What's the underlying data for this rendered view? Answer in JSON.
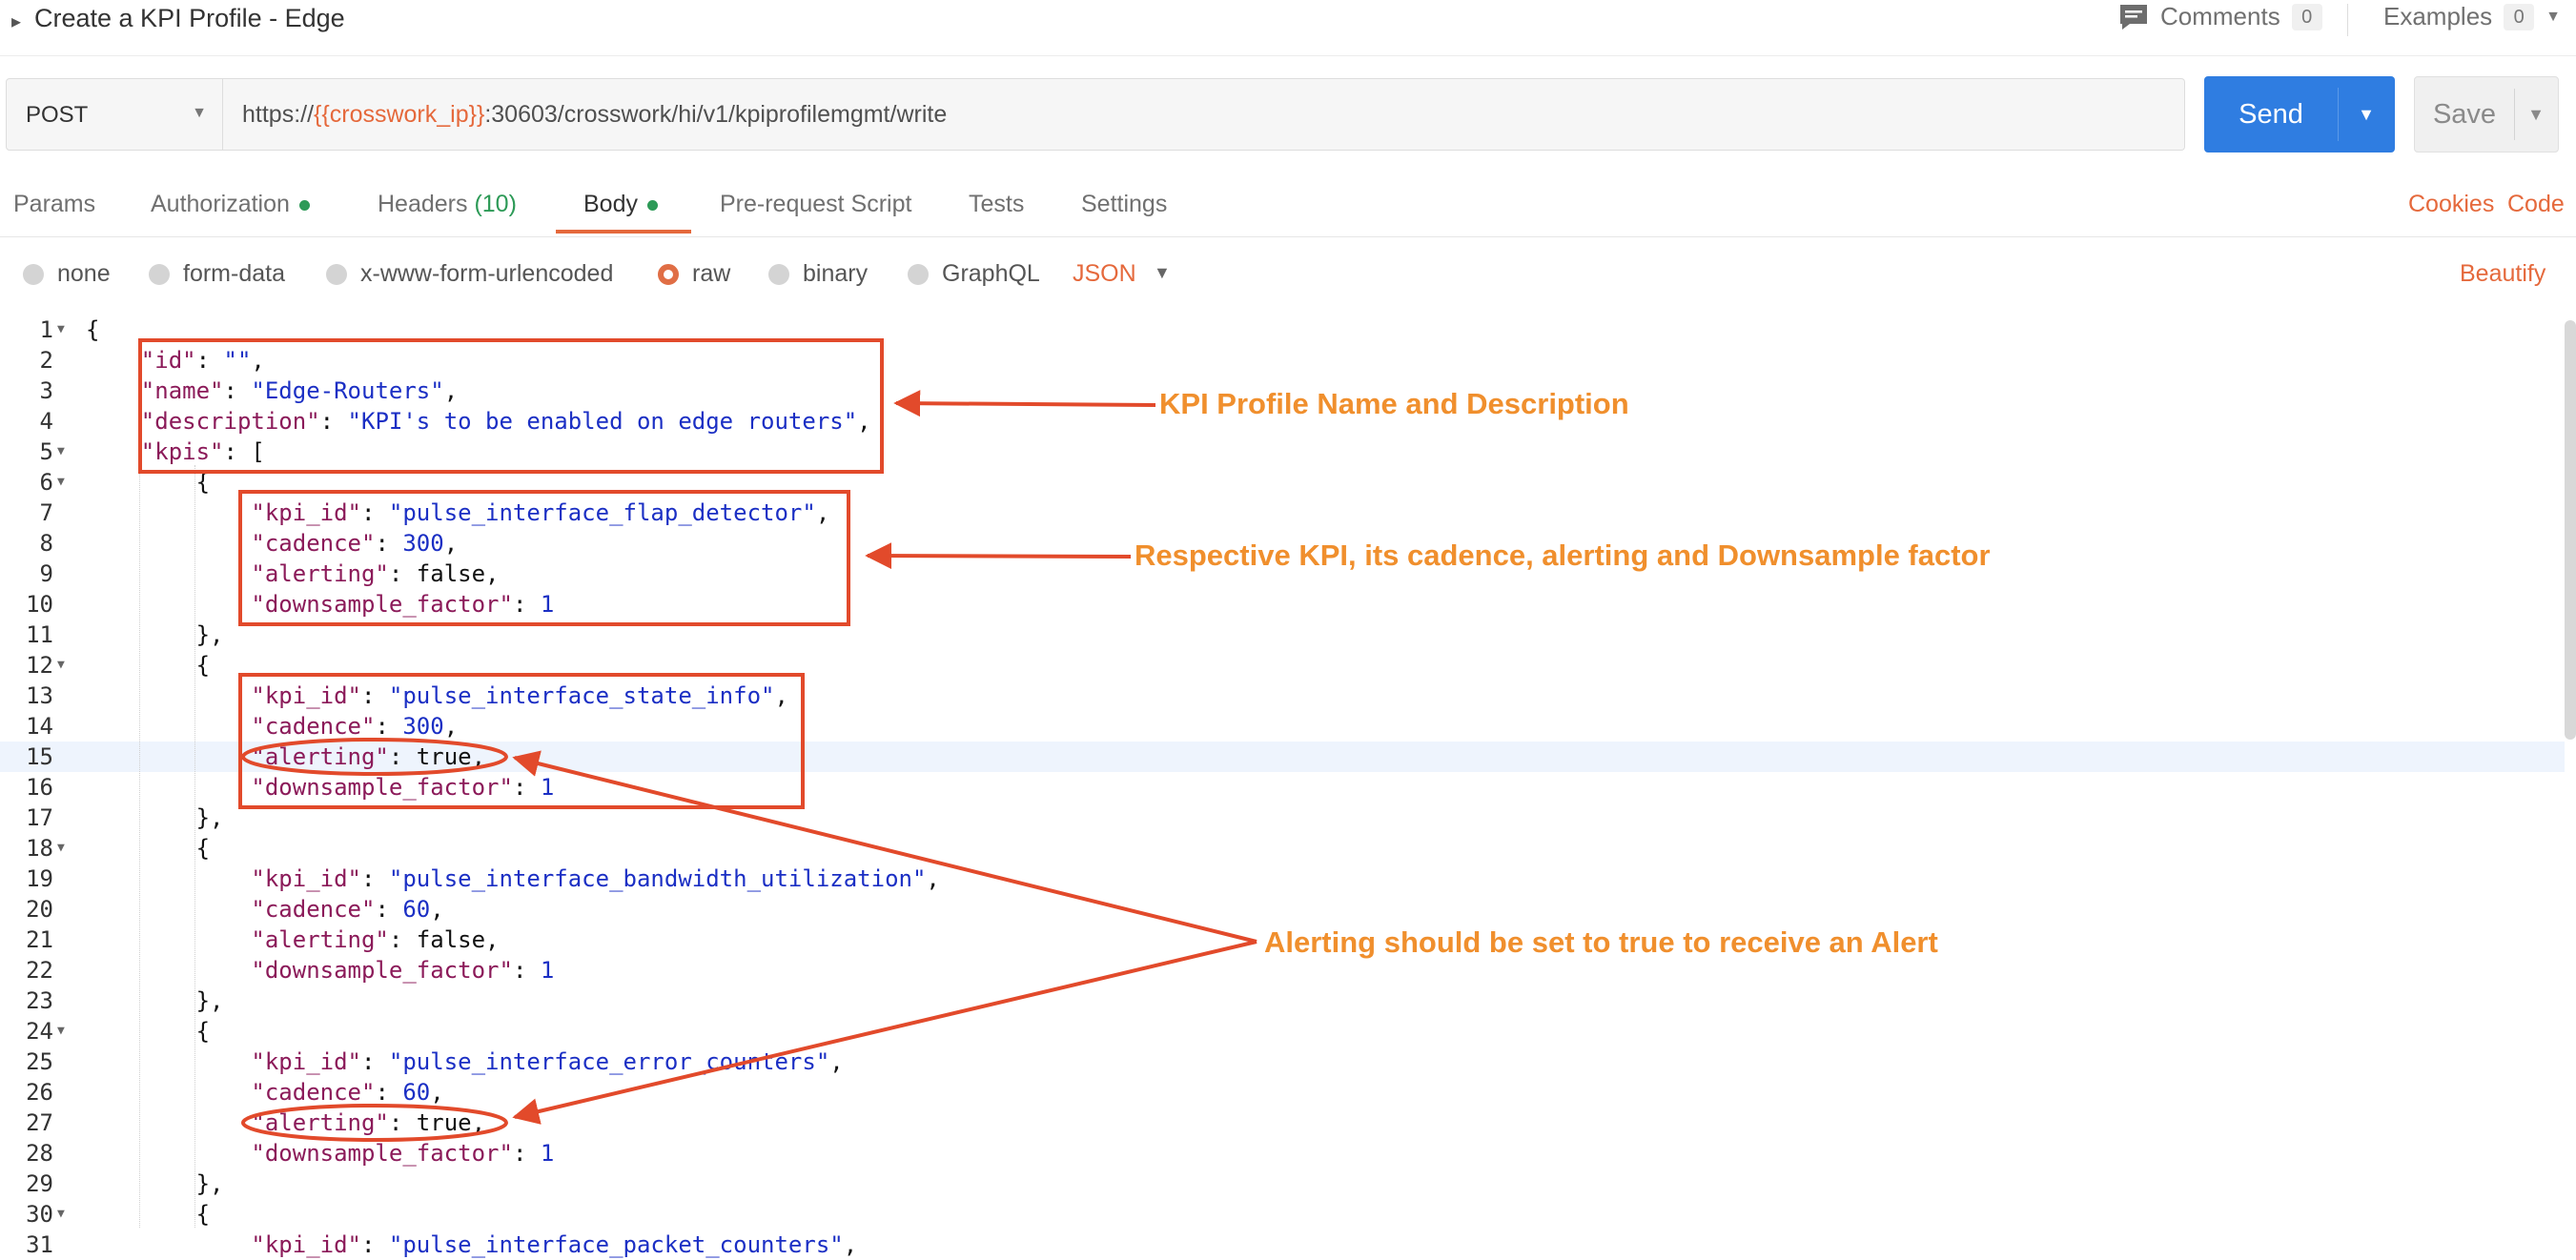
{
  "header": {
    "title": "Create a KPI Profile - Edge",
    "comments_label": "Comments",
    "comments_count": "0",
    "examples_label": "Examples",
    "examples_count": "0"
  },
  "request": {
    "method": "POST",
    "url_prefix": "https://",
    "url_variable": "{{crosswork_ip}}",
    "url_suffix": ":30603/crosswork/hi/v1/kpiprofilemgmt/write",
    "send_label": "Send",
    "save_label": "Save"
  },
  "tabs": {
    "params": "Params",
    "authorization": "Authorization",
    "headers": "Headers",
    "headers_count": "(10)",
    "body": "Body",
    "prerequest": "Pre-request Script",
    "tests": "Tests",
    "settings": "Settings",
    "cookies": "Cookies",
    "code": "Code"
  },
  "body_options": {
    "none": "none",
    "form_data": "form-data",
    "urlencoded": "x-www-form-urlencoded",
    "raw": "raw",
    "binary": "binary",
    "graphql": "GraphQL",
    "format": "JSON",
    "beautify": "Beautify"
  },
  "code_lines": [
    [
      {
        "c": "p",
        "t": "{"
      }
    ],
    [
      {
        "c": "p",
        "t": "    "
      },
      {
        "c": "k",
        "t": "\"id\""
      },
      {
        "c": "p",
        "t": ": "
      },
      {
        "c": "s",
        "t": "\"\""
      },
      {
        "c": "p",
        "t": ","
      }
    ],
    [
      {
        "c": "p",
        "t": "    "
      },
      {
        "c": "k",
        "t": "\"name\""
      },
      {
        "c": "p",
        "t": ": "
      },
      {
        "c": "s",
        "t": "\"Edge-Routers\""
      },
      {
        "c": "p",
        "t": ","
      }
    ],
    [
      {
        "c": "p",
        "t": "    "
      },
      {
        "c": "k",
        "t": "\"description\""
      },
      {
        "c": "p",
        "t": ": "
      },
      {
        "c": "s",
        "t": "\"KPI's to be enabled on edge routers\""
      },
      {
        "c": "p",
        "t": ","
      }
    ],
    [
      {
        "c": "p",
        "t": "    "
      },
      {
        "c": "k",
        "t": "\"kpis\""
      },
      {
        "c": "p",
        "t": ": ["
      }
    ],
    [
      {
        "c": "p",
        "t": "        {"
      }
    ],
    [
      {
        "c": "p",
        "t": "            "
      },
      {
        "c": "k",
        "t": "\"kpi_id\""
      },
      {
        "c": "p",
        "t": ": "
      },
      {
        "c": "s",
        "t": "\"pulse_interface_flap_detector\""
      },
      {
        "c": "p",
        "t": ","
      }
    ],
    [
      {
        "c": "p",
        "t": "            "
      },
      {
        "c": "k",
        "t": "\"cadence\""
      },
      {
        "c": "p",
        "t": ": "
      },
      {
        "c": "n",
        "t": "300"
      },
      {
        "c": "p",
        "t": ","
      }
    ],
    [
      {
        "c": "p",
        "t": "            "
      },
      {
        "c": "k",
        "t": "\"alerting\""
      },
      {
        "c": "p",
        "t": ": false,"
      }
    ],
    [
      {
        "c": "p",
        "t": "            "
      },
      {
        "c": "k",
        "t": "\"downsample_factor\""
      },
      {
        "c": "p",
        "t": ": "
      },
      {
        "c": "n",
        "t": "1"
      }
    ],
    [
      {
        "c": "p",
        "t": "        },"
      }
    ],
    [
      {
        "c": "p",
        "t": "        {"
      }
    ],
    [
      {
        "c": "p",
        "t": "            "
      },
      {
        "c": "k",
        "t": "\"kpi_id\""
      },
      {
        "c": "p",
        "t": ": "
      },
      {
        "c": "s",
        "t": "\"pulse_interface_state_info\""
      },
      {
        "c": "p",
        "t": ","
      }
    ],
    [
      {
        "c": "p",
        "t": "            "
      },
      {
        "c": "k",
        "t": "\"cadence\""
      },
      {
        "c": "p",
        "t": ": "
      },
      {
        "c": "n",
        "t": "300"
      },
      {
        "c": "p",
        "t": ","
      }
    ],
    [
      {
        "c": "p",
        "t": "            "
      },
      {
        "c": "k",
        "t": "\"alerting\""
      },
      {
        "c": "p",
        "t": ": true,"
      }
    ],
    [
      {
        "c": "p",
        "t": "            "
      },
      {
        "c": "k",
        "t": "\"downsample_factor\""
      },
      {
        "c": "p",
        "t": ": "
      },
      {
        "c": "n",
        "t": "1"
      }
    ],
    [
      {
        "c": "p",
        "t": "        },"
      }
    ],
    [
      {
        "c": "p",
        "t": "        {"
      }
    ],
    [
      {
        "c": "p",
        "t": "            "
      },
      {
        "c": "k",
        "t": "\"kpi_id\""
      },
      {
        "c": "p",
        "t": ": "
      },
      {
        "c": "s",
        "t": "\"pulse_interface_bandwidth_utilization\""
      },
      {
        "c": "p",
        "t": ","
      }
    ],
    [
      {
        "c": "p",
        "t": "            "
      },
      {
        "c": "k",
        "t": "\"cadence\""
      },
      {
        "c": "p",
        "t": ": "
      },
      {
        "c": "n",
        "t": "60"
      },
      {
        "c": "p",
        "t": ","
      }
    ],
    [
      {
        "c": "p",
        "t": "            "
      },
      {
        "c": "k",
        "t": "\"alerting\""
      },
      {
        "c": "p",
        "t": ": false,"
      }
    ],
    [
      {
        "c": "p",
        "t": "            "
      },
      {
        "c": "k",
        "t": "\"downsample_factor\""
      },
      {
        "c": "p",
        "t": ": "
      },
      {
        "c": "n",
        "t": "1"
      }
    ],
    [
      {
        "c": "p",
        "t": "        },"
      }
    ],
    [
      {
        "c": "p",
        "t": "        {"
      }
    ],
    [
      {
        "c": "p",
        "t": "            "
      },
      {
        "c": "k",
        "t": "\"kpi_id\""
      },
      {
        "c": "p",
        "t": ": "
      },
      {
        "c": "s",
        "t": "\"pulse_interface_error_counters\""
      },
      {
        "c": "p",
        "t": ","
      }
    ],
    [
      {
        "c": "p",
        "t": "            "
      },
      {
        "c": "k",
        "t": "\"cadence\""
      },
      {
        "c": "p",
        "t": ": "
      },
      {
        "c": "n",
        "t": "60"
      },
      {
        "c": "p",
        "t": ","
      }
    ],
    [
      {
        "c": "p",
        "t": "            "
      },
      {
        "c": "k",
        "t": "\"alerting\""
      },
      {
        "c": "p",
        "t": ": true,"
      }
    ],
    [
      {
        "c": "p",
        "t": "            "
      },
      {
        "c": "k",
        "t": "\"downsample_factor\""
      },
      {
        "c": "p",
        "t": ": "
      },
      {
        "c": "n",
        "t": "1"
      }
    ],
    [
      {
        "c": "p",
        "t": "        },"
      }
    ],
    [
      {
        "c": "p",
        "t": "        {"
      }
    ],
    [
      {
        "c": "p",
        "t": "            "
      },
      {
        "c": "k",
        "t": "\"kpi_id\""
      },
      {
        "c": "p",
        "t": ": "
      },
      {
        "c": "s",
        "t": "\"pulse_interface_packet_counters\""
      },
      {
        "c": "p",
        "t": ","
      }
    ]
  ],
  "fold_lines": [
    1,
    5,
    6,
    12,
    18,
    24,
    30
  ],
  "active_line": 15,
  "annotations": {
    "profile": "KPI Profile Name and Description",
    "kpi": "Respective KPI,  its cadence, alerting and Downsample factor",
    "alerting": "Alerting should be set to true to receive an Alert"
  },
  "colors": {
    "accent": "#e5693c",
    "send": "#2f7de1",
    "annotation_stroke": "#e24a2b",
    "annotation_text": "#f08f2d",
    "status_dot": "#2d9a57"
  }
}
